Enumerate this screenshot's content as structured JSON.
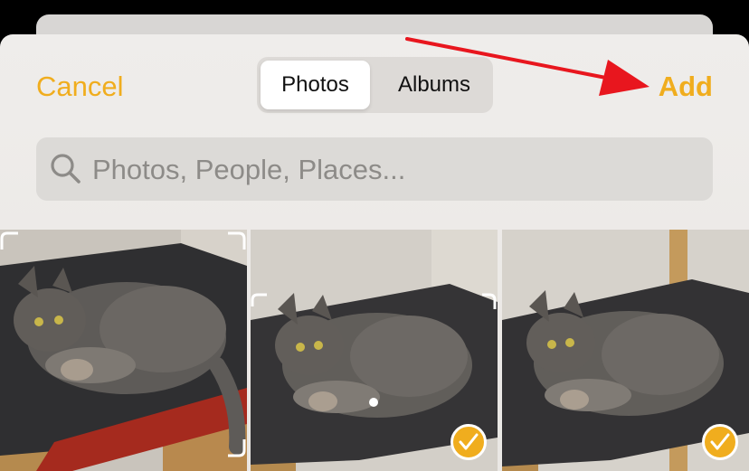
{
  "header": {
    "cancel_label": "Cancel",
    "add_label": "Add",
    "accent_color": "#f0ad1e"
  },
  "segmented_control": {
    "tabs": [
      {
        "label": "Photos",
        "selected": true
      },
      {
        "label": "Albums",
        "selected": false
      }
    ]
  },
  "search": {
    "placeholder": "Photos, People, Places..."
  },
  "grid": {
    "photos": [
      {
        "subject": "gray-tabby-cat-on-chair",
        "selected": false
      },
      {
        "subject": "gray-tabby-cat-on-chair",
        "selected": true
      },
      {
        "subject": "gray-tabby-cat-on-chair",
        "selected": true
      }
    ]
  },
  "annotation": {
    "arrow_color": "#e8161e",
    "points_to": "Add"
  }
}
